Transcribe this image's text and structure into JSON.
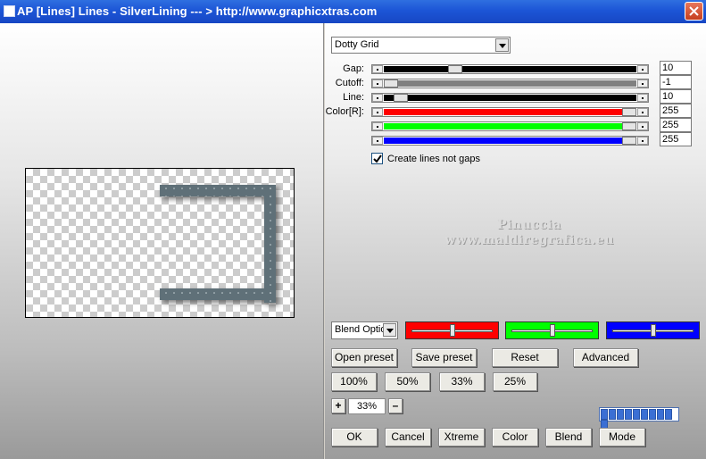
{
  "window": {
    "title": "AP [Lines]  Lines - SilverLining     --- > http://www.graphicxtras.com"
  },
  "style_select": {
    "value": "Dotty Grid"
  },
  "sliders": [
    {
      "label": "Gap:",
      "value": "10",
      "fill": "#000000",
      "position": 0.27
    },
    {
      "label": "Cutoff:",
      "value": "-1",
      "fill": "#808080",
      "position": 0.0
    },
    {
      "label": "Line:",
      "value": "10",
      "fill": "#000000",
      "position": 0.04
    },
    {
      "label": "Color[R]:",
      "value": "255",
      "fill": "#ff0000",
      "position": 1.0
    },
    {
      "label": "",
      "value": "255",
      "fill": "#00ff00",
      "position": 1.0
    },
    {
      "label": "",
      "value": "255",
      "fill": "#0000ff",
      "position": 1.0
    }
  ],
  "create_lines_checkbox": {
    "label": "Create lines not gaps",
    "checked": true
  },
  "watermark": {
    "line1": "Pinuccia",
    "line2": "www.maldiregrafica.eu"
  },
  "blend_select": {
    "value": "Blend Optio"
  },
  "color_boxes": [
    {
      "color": "#ff0000",
      "level": 0.5
    },
    {
      "color": "#00ff00",
      "level": 0.5
    },
    {
      "color": "#0000ff",
      "level": 0.5
    }
  ],
  "buttons": {
    "open_preset": "Open preset",
    "save_preset": "Save preset",
    "reset": "Reset",
    "advanced": "Advanced",
    "zoom_100": "100%",
    "zoom_50": "50%",
    "zoom_33": "33%",
    "zoom_25": "25%",
    "plus": "+",
    "minus": "–",
    "ok": "OK",
    "cancel": "Cancel",
    "xtreme": "Xtreme",
    "color": "Color",
    "blend": "Blend",
    "mode": "Mode"
  },
  "zoom": {
    "value": "33%"
  },
  "progress": {
    "segments": 10,
    "filled": 10
  },
  "preview": {
    "line_color": "#5f7078"
  }
}
